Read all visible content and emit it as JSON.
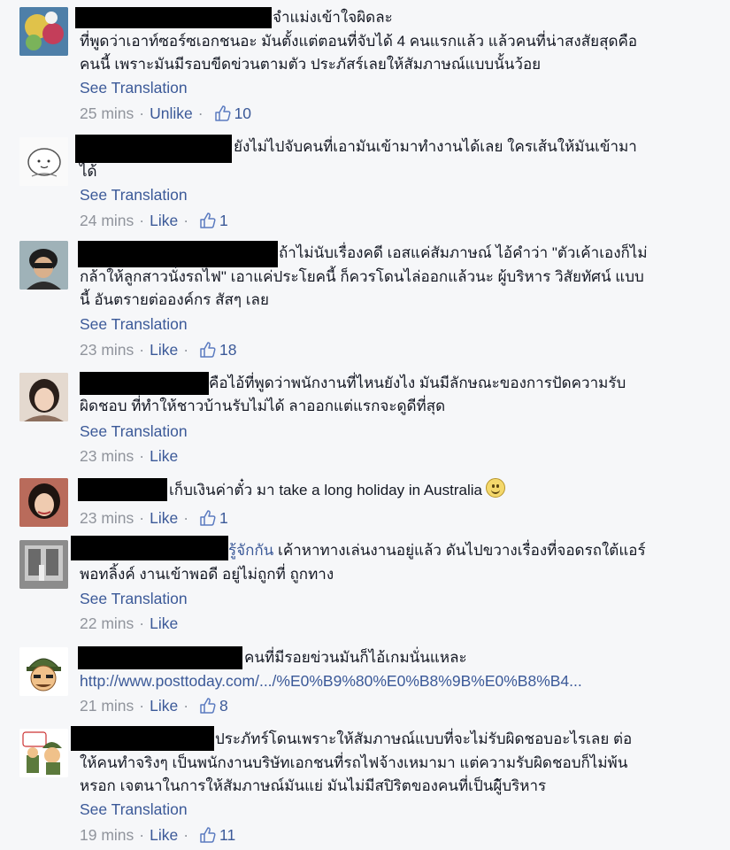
{
  "comments": [
    {
      "lines": [
        "จำแม่งเข้าใจผิดละ",
        "ที่พูดว่าเอาท์ซอร์ซเอกชนอะ มันตั้งแต่ตอนที่จับได้ 4 คนแรกแล้ว แล้วคนที่น่าสงสัยสุดคือ",
        "คนนี้ เพราะมันมีรอบขีดข่วนตามตัว ประภัสร์เลยให้สัมภาษณ์แบบนั้นว้อย"
      ],
      "translation": "See Translation",
      "time": "25 mins",
      "action": "Unlike",
      "likes": "10"
    },
    {
      "lines": [
        "ยังไม่ไปจับคนที่เอามันเข้ามาทำงานได้เลย ใครเส้นให้มันเข้ามา",
        "ได้"
      ],
      "translation": "See Translation",
      "time": "24 mins",
      "action": "Like",
      "likes": "1"
    },
    {
      "lines": [
        "ถ้าไม่นับเรื่องคดี เอสแค่สัมภาษณ์ ไอ้คำว่า \"ตัวเค้าเองก็ไม่",
        "กล้าให้ลูกสาวนั่งรถไฟ\" เอาแค่ประโยคนี้ ก็ควรโดนไล่ออกแล้วนะ ผู้บริหาร วิสัยทัศน์ แบบ",
        "นี้ อันตรายต่อองค์กร สัสๆ เลย"
      ],
      "translation": "See Translation",
      "time": "23 mins",
      "action": "Like",
      "likes": "18"
    },
    {
      "lines": [
        "คือไอ้ที่พูดว่าพนักงานที่ไหนยังไง มันมีลักษณะของการปัดความรับ",
        "ผิดชอบ ที่ทำให้ชาวบ้านรับไม่ได้ ลาออกแต่แรกจะดูดีที่สุด"
      ],
      "translation": "See Translation",
      "time": "23 mins",
      "action": "Like",
      "likes": ""
    },
    {
      "lines": [
        "เก็บเงินค่าตั๋ว มา take a long holiday in Australia"
      ],
      "translation": "",
      "time": "23 mins",
      "action": "Like",
      "likes": "1"
    },
    {
      "name_suffix": "รู้จักกัน",
      "lines": [
        " เค้าหาทางเล่นงานอยู่แล้ว ดันไปขวางเรื่องที่จอดรถใต้แอร์",
        "พอทลิ้งค์ งานเข้าพอดี อยู่ไม่ถูกที่ ถูกทาง"
      ],
      "translation": "See Translation",
      "time": "22 mins",
      "action": "Like",
      "likes": ""
    },
    {
      "lines": [
        "คนที่มีรอยข่วนมันก็ไอ้เกมนั่นแหละ"
      ],
      "link": "http://www.posttoday.com/.../%E0%B9%80%E0%B8%9B%E0%B8%B4...",
      "translation": "",
      "time": "21 mins",
      "action": "Like",
      "likes": "8"
    },
    {
      "lines": [
        "ประภัทร์โดนเพราะให้สัมภาษณ์แบบที่จะไม่รับผิดชอบอะไรเลย ต่อ",
        "ให้คนทำจริงๆ เป็นพนักงานบริษัทเอกชนที่รถไฟจ้างเหมามา แต่ความรับผิดชอบก็ไม่พ้น",
        "หรอก เจตนาในการให้สัมภาษณ์มันแย่ มันไม่มีสปิริตของคนที่เป็นผู้ิบริหาร"
      ],
      "translation": "See Translation",
      "time": "19 mins",
      "action": "Like",
      "likes": "11"
    }
  ],
  "separator": "·",
  "colors": {
    "link": "#3b5998",
    "meta": "#90949c",
    "text": "#141823",
    "background": "#f6f7f9"
  },
  "icons": {
    "like": "thumbs-up-icon",
    "smile": "smile-emoji-icon"
  }
}
